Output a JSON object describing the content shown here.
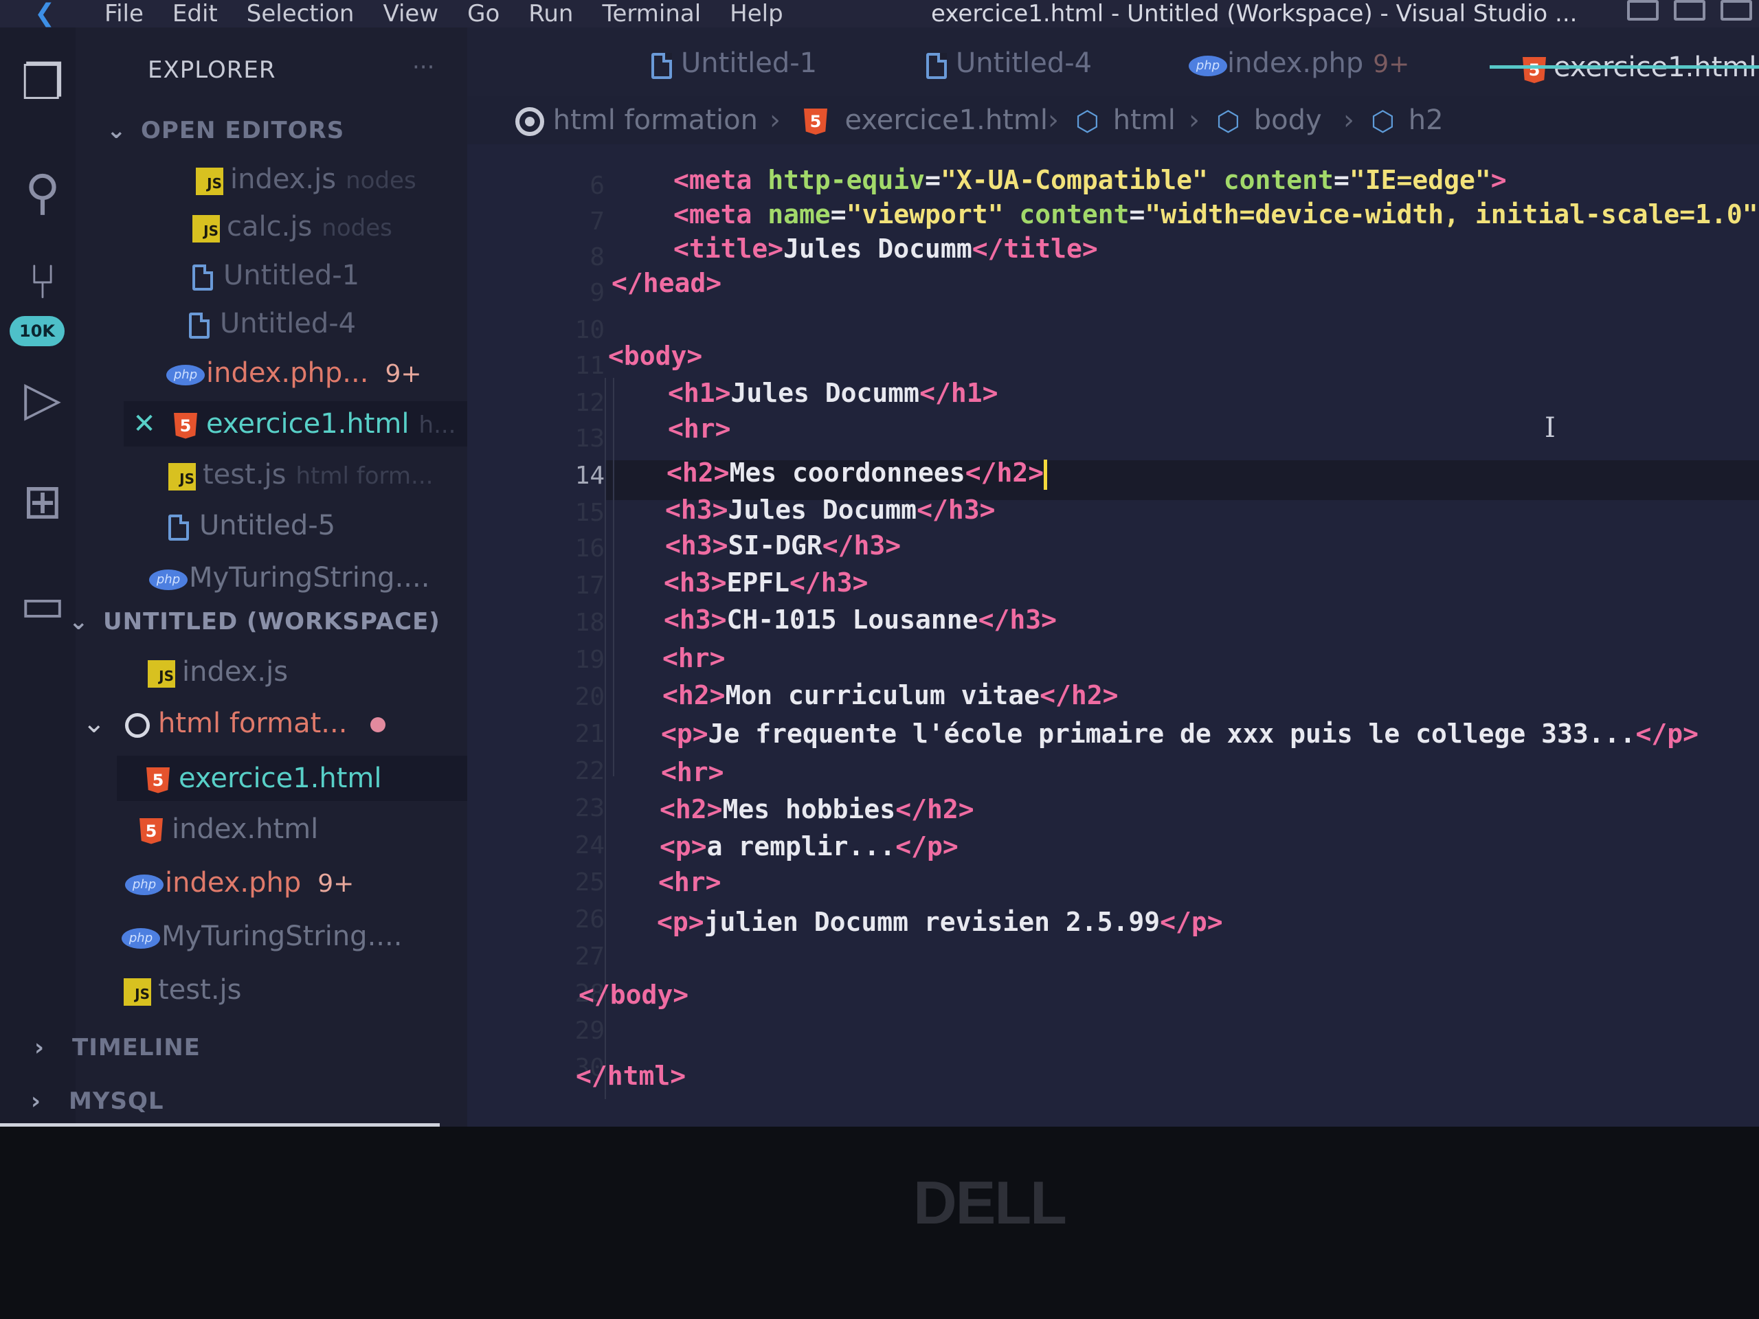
{
  "menubar": {
    "items": [
      "File",
      "Edit",
      "Selection",
      "View",
      "Go",
      "Run",
      "Terminal",
      "Help"
    ],
    "window_title": "exercice1.html - Untitled (Workspace) - Visual Studio ..."
  },
  "activity_bar": {
    "icons": [
      "files-icon",
      "search-icon",
      "source-control-icon",
      "run-debug-icon",
      "extensions-icon",
      "remote-explorer-icon"
    ],
    "source_control_badge": "10K"
  },
  "sidebar": {
    "title": "EXPLORER",
    "more": "···",
    "open_editors": {
      "label": "OPEN EDITORS",
      "items": [
        {
          "name": "index.js",
          "desc": "nodes",
          "icon": "js"
        },
        {
          "name": "calc.js",
          "desc": "nodes",
          "icon": "js"
        },
        {
          "name": "Untitled-1",
          "desc": "",
          "icon": "file"
        },
        {
          "name": "Untitled-4",
          "desc": "",
          "icon": "file"
        },
        {
          "name": "index.php...",
          "badge": "9+",
          "icon": "php"
        },
        {
          "name": "exercice1.html",
          "desc": "h...",
          "icon": "html"
        },
        {
          "name": "test.js",
          "desc": "html form...",
          "icon": "js"
        },
        {
          "name": "Untitled-5",
          "desc": "",
          "icon": "file"
        },
        {
          "name": "MyTuringString....",
          "desc": "",
          "icon": "php"
        }
      ]
    },
    "workspace": {
      "label": "UNTITLED (WORKSPACE)",
      "items": [
        {
          "name": "index.js",
          "icon": "js"
        },
        {
          "name": "html format...",
          "icon": "folder"
        },
        {
          "name": "exercice1.html",
          "icon": "html"
        },
        {
          "name": "index.html",
          "icon": "html"
        },
        {
          "name": "index.php",
          "badge": "9+",
          "icon": "php"
        },
        {
          "name": "MyTuringString....",
          "icon": "php"
        },
        {
          "name": "test.js",
          "icon": "js"
        }
      ]
    },
    "timeline_label": "TIMELINE",
    "mysql_label": "MYSQL"
  },
  "tabs": [
    {
      "label": "Untitled-1",
      "icon": "file"
    },
    {
      "label": "Untitled-4",
      "icon": "file"
    },
    {
      "label": "index.php",
      "badge": "9+",
      "icon": "php"
    },
    {
      "label": "exercice1.html",
      "icon": "html",
      "active": true
    }
  ],
  "breadcrumb": [
    "html formation",
    "exercice1.html",
    "html",
    "body",
    "h2"
  ],
  "editor": {
    "line_numbers": [
      "6",
      "7",
      "8",
      "9",
      "10",
      "11",
      "12",
      "13",
      "14",
      "15",
      "16",
      "17",
      "18",
      "19",
      "20",
      "21",
      "22",
      "23",
      "24",
      "25",
      "26",
      "27",
      "28",
      "29",
      "30"
    ],
    "active_line": "14"
  },
  "brand": "DELL"
}
